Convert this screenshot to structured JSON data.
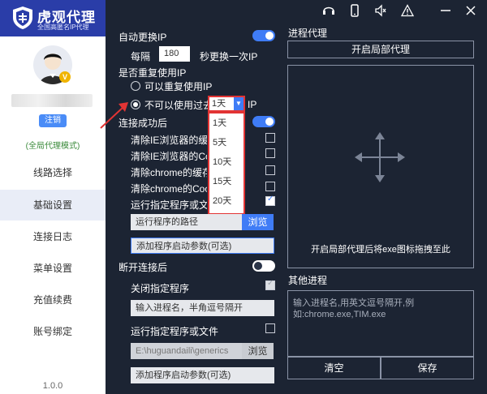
{
  "sidebar": {
    "logo_title": "虎观代理",
    "logo_subtitle": "全国高匿名IP代理",
    "avatar_badge": "V",
    "logout_label": "注销",
    "mode_label": "(全局代理模式)",
    "items": [
      {
        "label": "线路选择"
      },
      {
        "label": "基础设置"
      },
      {
        "label": "连接日志"
      },
      {
        "label": "菜单设置"
      },
      {
        "label": "充值续费"
      },
      {
        "label": "账号绑定"
      }
    ],
    "version": "1.0.0"
  },
  "settings": {
    "auto_change_label": "自动更换IP",
    "interval_prefix": "每隔",
    "interval_value": "180",
    "interval_suffix": "秒更换一次IP",
    "reuse_label": "是否重复使用IP",
    "radio_reuse": "可以重复使用IP",
    "radio_noreuse": "不可以使用过去",
    "ip_suffix": "IP",
    "dropdown_value": "1天",
    "dropdown_options": [
      "1天",
      "5天",
      "10天",
      "15天",
      "20天"
    ],
    "after_connect_label": "连接成功后",
    "clear_ie_cache": "清除IE浏览器的缓存",
    "clear_ie_cookie": "清除IE浏览器的Cookie",
    "clear_chrome_cache": "清除chrome的缓存",
    "clear_chrome_cookie": "清除chrome的Cookie",
    "run_program": "运行指定程序或文件",
    "program_path_placeholder": "运行程序的路径",
    "browse_label": "浏览",
    "add_params_placeholder": "添加程序启动参数(可选)",
    "after_disconnect_label": "断开连接后",
    "close_program": "关闭指定程序",
    "process_name_placeholder": "输入进程名，半角逗号隔开",
    "run_program2": "运行指定程序或文件",
    "program_path2": "E:\\huguandaili\\generics",
    "browse_label2": "浏览",
    "add_params_placeholder2": "添加程序启动参数(可选)"
  },
  "process": {
    "title": "进程代理",
    "partial_button": "开启局部代理",
    "drop_hint": "开启局部代理后将exe图标拖拽至此",
    "other_title": "其他进程",
    "other_placeholder": "输入进程名,用英文逗号隔开,例如:chrome.exe,TIM.exe",
    "clear_button": "清空",
    "save_button": "保存"
  },
  "top_icons": [
    "headset-icon",
    "phone-icon",
    "volume-icon",
    "warning-icon",
    "minimize-icon",
    "close-icon"
  ],
  "colors": {
    "accent": "#3f7cf6",
    "background": "#1c2433",
    "highlight": "#e23434"
  }
}
